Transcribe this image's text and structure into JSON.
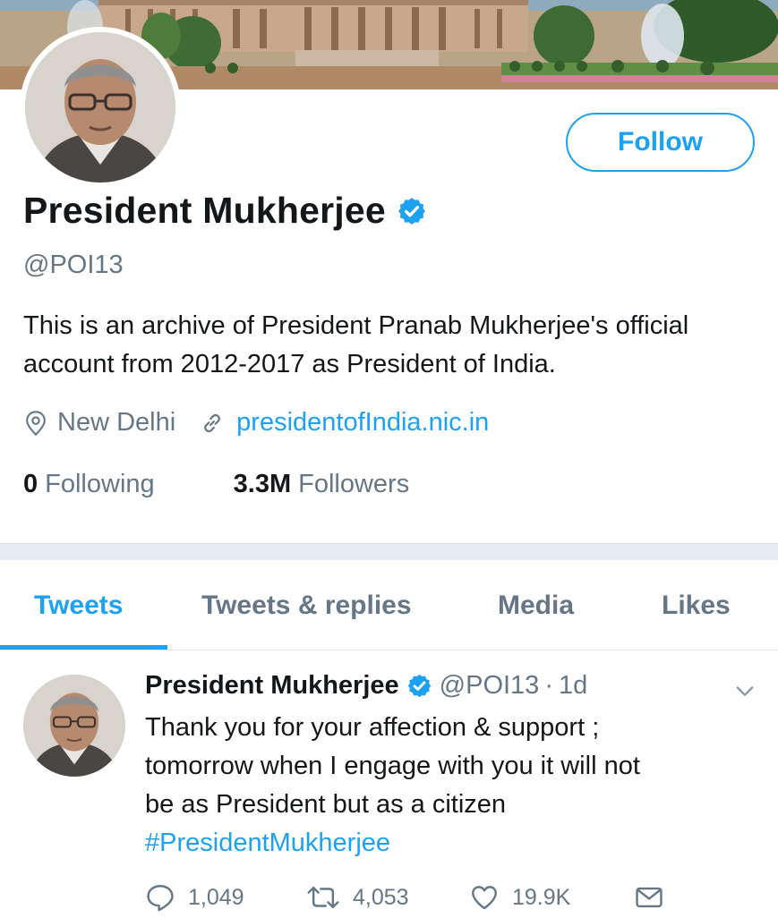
{
  "profile": {
    "name": "President Mukherjee",
    "handle": "@POI13",
    "bio": "This is an archive of President Pranab Mukherjee's official account from 2012-2017 as President of India.",
    "location": "New Delhi",
    "website": "presidentofIndia.nic.in",
    "following_count": "0",
    "following_label": "Following",
    "followers_count": "3.3M",
    "followers_label": "Followers",
    "follow_label": "Follow",
    "verified_icon": "verified-badge-icon"
  },
  "tabs": [
    {
      "label": "Tweets",
      "active": true
    },
    {
      "label": "Tweets & replies",
      "active": false
    },
    {
      "label": "Media",
      "active": false
    },
    {
      "label": "Likes",
      "active": false
    }
  ],
  "tweet": {
    "name": "President Mukherjee",
    "handle": "@POI13",
    "separator": "·",
    "time": "1d",
    "text_lines": [
      "Thank you for your affection & support ;",
      "tomorrow when I engage with you it will not",
      "be as President but as a citizen"
    ],
    "hashtag": "#PresidentMukherjee",
    "replies": "1,049",
    "retweets": "4,053",
    "likes": "19.9K"
  },
  "colors": {
    "accent": "#1da1f2",
    "secondary_text": "#657786",
    "primary_text": "#14171a",
    "divider": "#e6ecf0"
  }
}
